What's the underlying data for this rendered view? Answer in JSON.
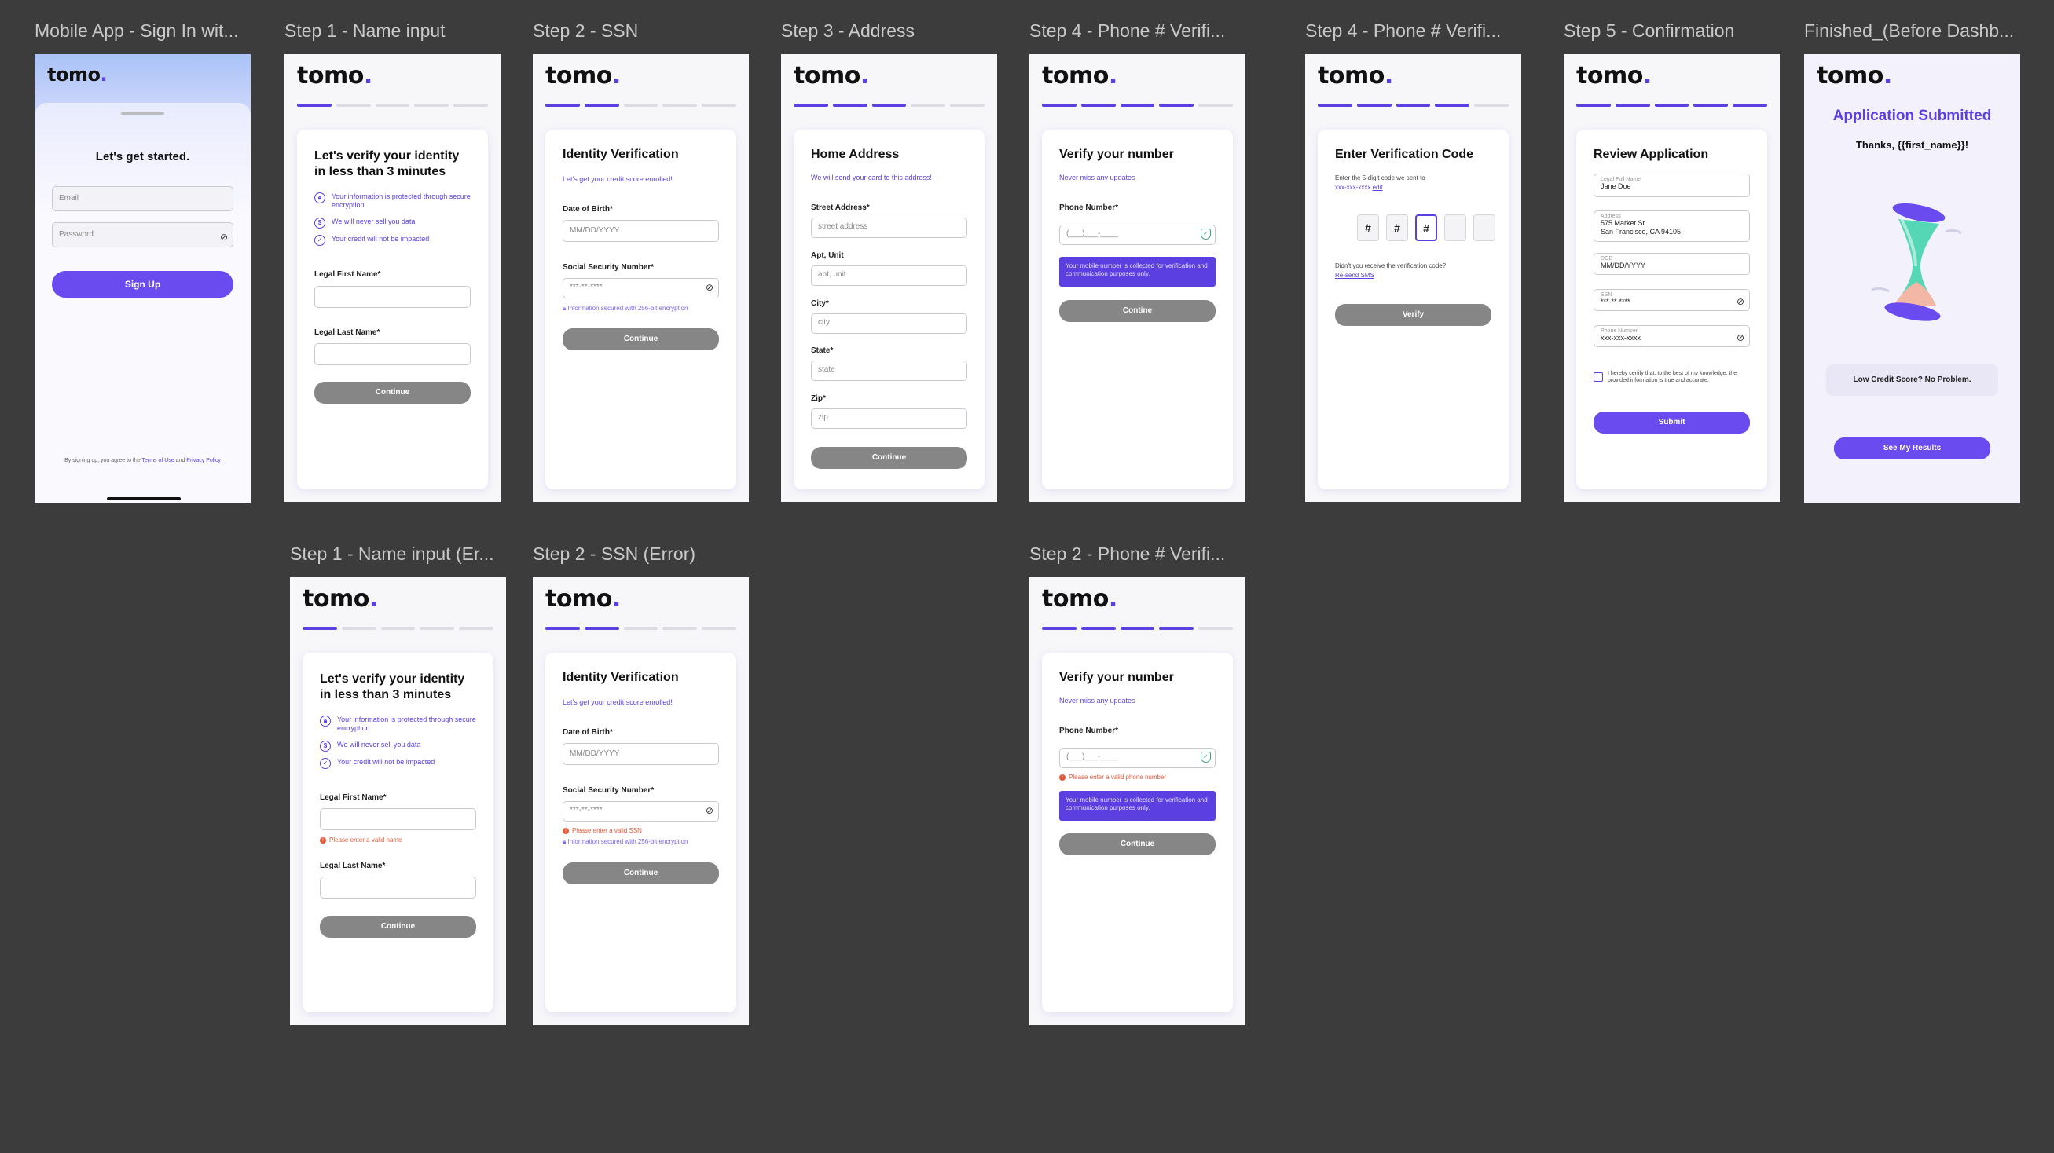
{
  "brand": {
    "logo": "tomo",
    "dot": "."
  },
  "colors": {
    "accent": "#5b3fe0",
    "button_disabled": "#868686",
    "error": "#e05a3a",
    "canvas": "#3c3c3c"
  },
  "frames": {
    "signin": {
      "label": "Mobile App - Sign In wit...",
      "heading": "Let's get started.",
      "email_placeholder": "Email",
      "password_placeholder": "Password",
      "button": "Sign Up",
      "legal_prefix": "By signing up, you agree to the",
      "terms": "Terms of Use",
      "and": "and",
      "privacy": "Privacy Policy"
    },
    "step1": {
      "label": "Step 1 - Name input",
      "title": "Let's verify your identity in less than 3 minutes",
      "bullets": [
        "Your information is protected through secure encryption",
        "We will never sell you data",
        "Your credit will not be impacted"
      ],
      "first_label": "Legal First Name*",
      "last_label": "Legal Last Name*",
      "button": "Continue"
    },
    "step2": {
      "label": "Step 2 - SSN",
      "title": "Identity Verification",
      "sub": "Let's get your credit score enrolled!",
      "dob_label": "Date of Birth*",
      "dob_placeholder": "MM/DD/YYYY",
      "ssn_label": "Social Security Number*",
      "ssn_placeholder": "***-**-****",
      "secure_note": "Information secured with 256-bit encryption",
      "button": "Continue"
    },
    "step3": {
      "label": "Step 3 - Address",
      "title": "Home Address",
      "sub": "We will send your card to this address!",
      "fields": [
        {
          "label": "Street Address*",
          "placeholder": "street address"
        },
        {
          "label": "Apt, Unit",
          "placeholder": "apt, unit"
        },
        {
          "label": "City*",
          "placeholder": "city"
        },
        {
          "label": "State*",
          "placeholder": "state"
        },
        {
          "label": "Zip*",
          "placeholder": "zip"
        }
      ],
      "button": "Continue"
    },
    "step4a": {
      "label": "Step 4 - Phone # Verifi...",
      "title": "Verify your number",
      "sub": "Never miss any updates",
      "phone_label": "Phone Number*",
      "phone_placeholder": "(___)___-____",
      "notice": "Your mobile number is collected for verification and communication purposes only.",
      "button": "Contine"
    },
    "step4b": {
      "label": "Step 4 - Phone # Verifi...",
      "title": "Enter Verification Code",
      "instruction": "Enter the 5-digit code we sent to",
      "masked": "xxx-xxx-xxxx",
      "edit": "edit",
      "codes": [
        "#",
        "#",
        "#",
        "",
        ""
      ],
      "resend_q": "Didn't you receive the verification code?",
      "resend": "Re-send SMS",
      "button": "Verify"
    },
    "step5": {
      "label": "Step 5 - Confirmation",
      "title": "Review Application",
      "fields": [
        {
          "label": "Legal Full Name",
          "value": "Jane Doe"
        },
        {
          "label": "Address",
          "value": "575 Market St.\nSan Francisco, CA 94105"
        },
        {
          "label": "DOB",
          "value": "MM/DD/YYYY"
        },
        {
          "label": "SSN",
          "value": "***-**-****"
        },
        {
          "label": "Phone Number",
          "value": "xxx-xxx-xxxx"
        }
      ],
      "certify": "I hereby certify that, to the best of my knowledge, the provided information is true and accurate.",
      "button": "Submit"
    },
    "finished": {
      "label": "Finished_(Before Dashb...",
      "title": "Application Submitted",
      "thanks": "Thanks, {{first_name}}!",
      "pill": "Low Credit Score? No Problem.",
      "button": "See My Results"
    },
    "step1err": {
      "label": "Step 1 - Name input (Er...",
      "error": "Please enter a valid name"
    },
    "step2err": {
      "label": "Step 2 - SSN (Error)",
      "error": "Please enter a valid SSN"
    },
    "step2phone": {
      "label": "Step 2 - Phone # Verifi...",
      "error": "Please enter a valid phone number"
    }
  }
}
